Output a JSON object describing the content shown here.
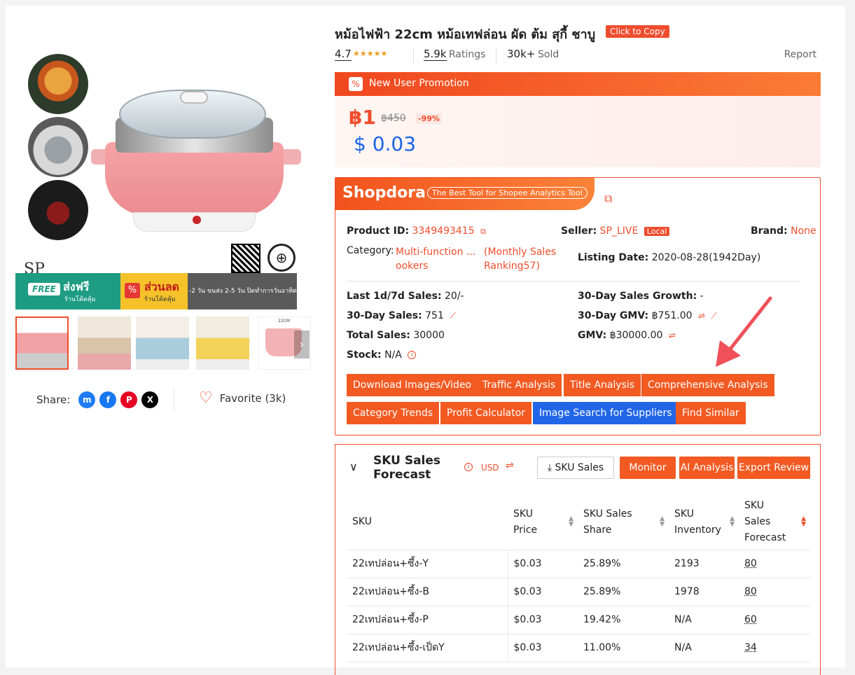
{
  "product": {
    "title": "หม้อไฟฟ้า 22cm หม้อเทฟล่อน ผัด ต้ม สุกี้ ชาบู",
    "copy_label": "Click to Copy",
    "rating": "4.7",
    "ratings_count": "5.9k",
    "ratings_label": "Ratings",
    "sold_count": "30k+",
    "sold_label": "Sold",
    "report_label": "Report"
  },
  "image_overlay": {
    "brand_mark": "SP",
    "free_badge": "FREE",
    "free_title": "ส่งฟรี",
    "free_sub": "ร้านโค้ดคุ้ม",
    "discount_title": "ส่วนลด",
    "discount_sub": "ร้านโค้ดคุ้ม",
    "shipping_note": "-2 วัน ขนส่ง 2-5 วัน ปิดทำการวันอาทิตย์",
    "size_label": "22CM"
  },
  "promotion": {
    "label": "New User Promotion",
    "price": "฿1",
    "original_price": "฿450",
    "discount": "-99%",
    "usd_price": "$ 0.03"
  },
  "share": {
    "label": "Share:",
    "favorite_label": "Favorite (3k)"
  },
  "shopdora": {
    "logo": "Shopdora",
    "tagline": "The Best Tool for Shopee Analytics Tool",
    "product_id_label": "Product ID:",
    "product_id": "3349493415",
    "seller_label": "Seller:",
    "seller": "SP_LIVE",
    "seller_badge": "Local",
    "brand_label": "Brand:",
    "brand": "None",
    "category_label": "Category:",
    "category_line1": "Multi-function ...",
    "category_line2": "ookers",
    "ranking_line1": "(Monthly Sales",
    "ranking_line2": "Ranking57)",
    "listing_date_label": "Listing Date:",
    "listing_date": "2020-08-28(1942Day)",
    "last_sales_label": "Last 1d/7d Sales:",
    "last_sales": "20/-",
    "growth_label": "30-Day Sales Growth:",
    "growth": "-",
    "sales30_label": "30-Day Sales:",
    "sales30": "751",
    "gmv30_label": "30-Day GMV:",
    "gmv30": "฿751.00",
    "total_sales_label": "Total Sales:",
    "total_sales": "30000",
    "gmv_label": "GMV:",
    "gmv": "฿30000.00",
    "stock_label": "Stock:",
    "stock": "N/A",
    "buttons": {
      "download": "Download Images/Video",
      "traffic": "Traffic Analysis",
      "title": "Title Analysis",
      "comprehensive": "Comprehensive Analysis",
      "category": "Category Trends",
      "profit": "Profit Calculator",
      "image_search": "Image Search for Suppliers",
      "similar": "Find Similar"
    }
  },
  "sku": {
    "title": "SKU Sales Forecast",
    "currency": "USD",
    "sku_sales_button": "SKU Sales",
    "monitor_button": "Monitor",
    "ai_button": "AI Analysis",
    "export_button": "Export Review",
    "headers": {
      "sku": "SKU",
      "price_1": "SKU",
      "price_2": "Price",
      "share_1": "SKU Sales",
      "share_2": "Share",
      "inventory_1": "SKU",
      "inventory_2": "Inventory",
      "forecast_1": "SKU",
      "forecast_2": "Sales",
      "forecast_3": "Forecast"
    },
    "rows": [
      {
        "name": "22เทปล่อน+ซึ้ง-Y",
        "price": "$0.03",
        "share": "25.89%",
        "inventory": "2193",
        "forecast": "80"
      },
      {
        "name": "22เทปล่อน+ซึ้ง-B",
        "price": "$0.03",
        "share": "25.89%",
        "inventory": "1978",
        "forecast": "80"
      },
      {
        "name": "22เทปล่อน+ซึ้ง-P",
        "price": "$0.03",
        "share": "19.42%",
        "inventory": "N/A",
        "forecast": "60"
      },
      {
        "name": "22เทปล่อน+ซึ้ง-เป็ดY",
        "price": "$0.03",
        "share": "11.00%",
        "inventory": "N/A",
        "forecast": "34"
      }
    ]
  },
  "colors": {
    "accent": "#ee4d2d",
    "blue": "#2266e8",
    "usd_price": "#1a63e8"
  }
}
